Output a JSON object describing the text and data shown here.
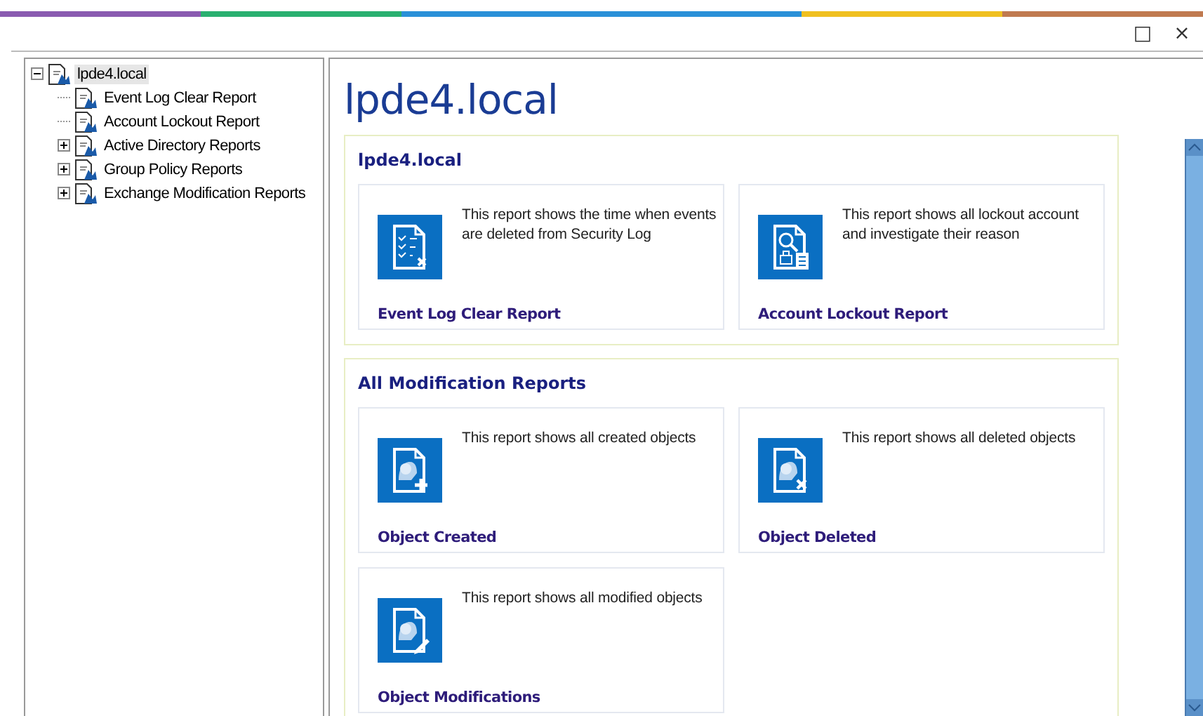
{
  "window": {
    "maximize": "□",
    "close": "×"
  },
  "tree": [
    {
      "label": "lpde4.local",
      "selected": true,
      "expanded": true,
      "children": [
        {
          "label": "Event Log Clear Report",
          "selected": false
        },
        {
          "label": "Account Lockout Report",
          "selected": false
        },
        {
          "label": "Active Directory Reports",
          "selected": false,
          "expanded": false
        },
        {
          "label": "Group Policy Reports",
          "selected": false,
          "expanded": false
        },
        {
          "label": "Exchange Modification Reports",
          "selected": false,
          "expanded": false
        }
      ]
    }
  ],
  "page_title": "lpde4.local",
  "sections": [
    {
      "heading": "lpde4.local",
      "cards": [
        {
          "kind": "log-clear",
          "description": "This report shows the time when events are deleted from Security Log",
          "title": "Event Log Clear Report"
        },
        {
          "kind": "lockout",
          "description": "This report shows all lockout account and investigate their reason",
          "title": "Account Lockout Report"
        }
      ]
    },
    {
      "heading": "All Modification Reports",
      "cards": [
        {
          "kind": "created",
          "description": "This report shows all created objects",
          "title": "Object Created"
        },
        {
          "kind": "deleted",
          "description": "This report shows all deleted objects",
          "title": "Object Deleted"
        },
        {
          "kind": "modified",
          "description": "This report shows all modified objects",
          "title": "Object Modifications"
        }
      ]
    }
  ]
}
